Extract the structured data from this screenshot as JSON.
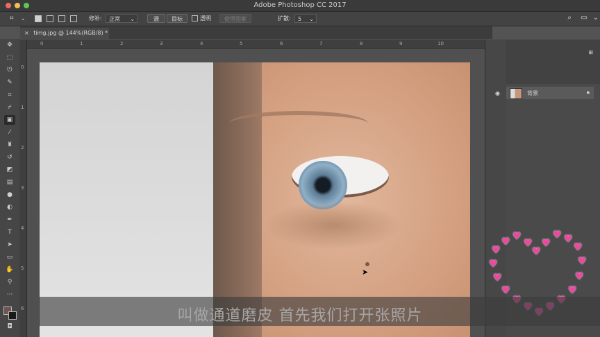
{
  "window": {
    "title": "Adobe Photoshop CC 2017"
  },
  "options_bar": {
    "patch_label": "修补:",
    "patch_mode": "正常",
    "source_button": "源",
    "target_button": "目标",
    "transparent_label": "透明",
    "use_pattern_button": "使用图案",
    "diffusion_label": "扩散:",
    "diffusion_value": "5"
  },
  "document": {
    "tab_label": "timg.jpg @ 144%(RGB/8) *"
  },
  "ruler": {
    "ticks": [
      "0",
      "1",
      "2",
      "3",
      "4",
      "5",
      "6",
      "7",
      "8",
      "9",
      "10"
    ]
  },
  "layers": [
    {
      "name": "背景",
      "visible": true,
      "locked": true
    }
  ],
  "caption": "叫做通道磨皮 首先我们打开张照片",
  "colors": {
    "accent_heart": "#ef46a0",
    "titlebar": "#3a3a3a"
  },
  "tools": [
    "move-icon",
    "marquee-icon",
    "lasso-icon",
    "quick-select-icon",
    "crop-icon",
    "eyedropper-icon",
    "patch-icon",
    "brush-icon",
    "stamp-icon",
    "history-brush-icon",
    "eraser-icon",
    "gradient-icon",
    "blur-icon",
    "dodge-icon",
    "pen-icon",
    "type-icon",
    "path-select-icon",
    "shape-icon",
    "hand-icon",
    "zoom-icon",
    "more-icon"
  ]
}
